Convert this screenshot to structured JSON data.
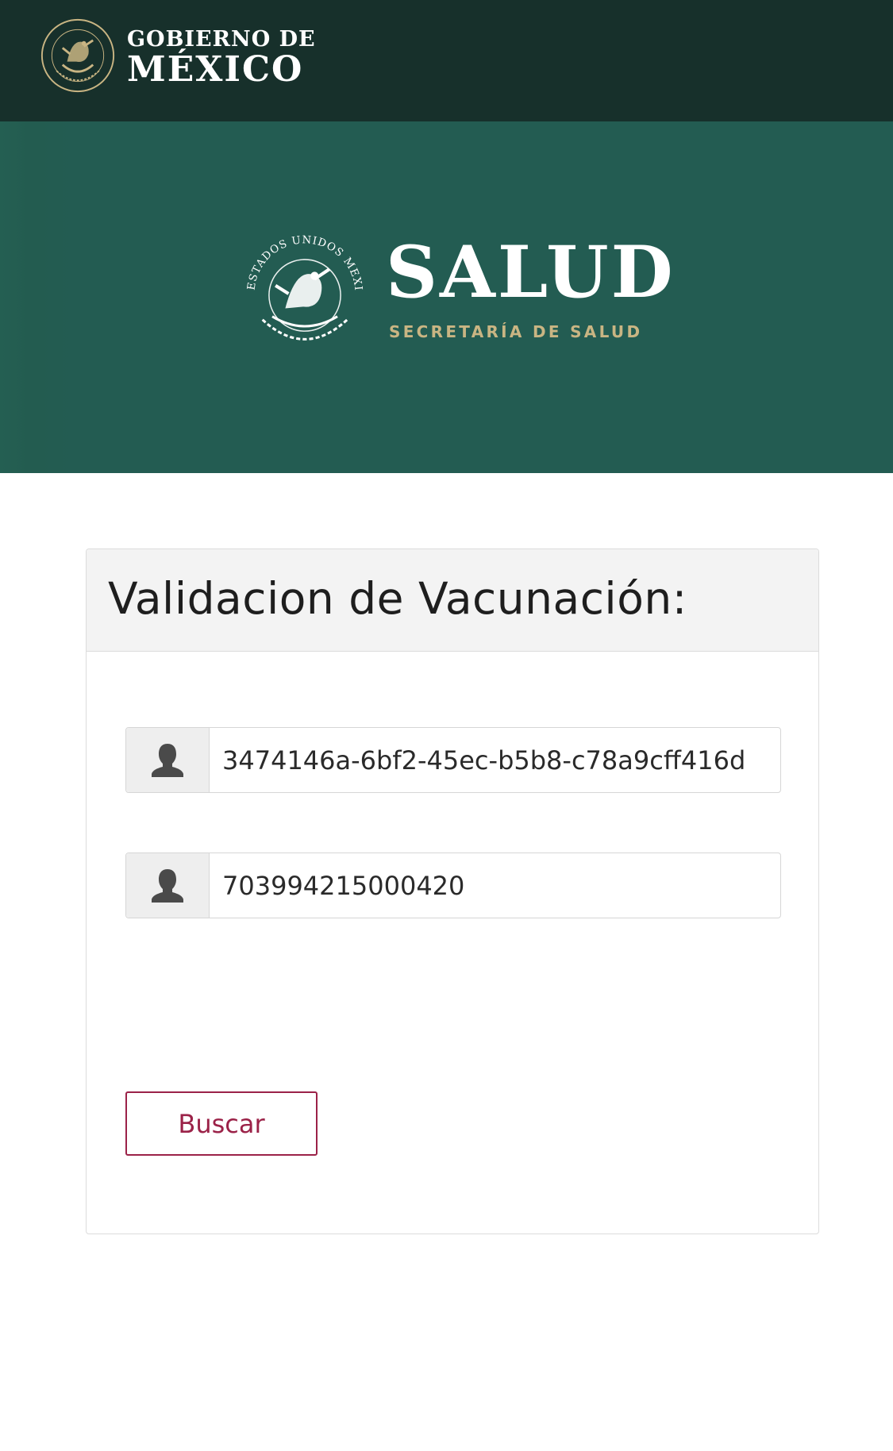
{
  "header": {
    "line1": "GOBIERNO DE",
    "line2": "MÉXICO",
    "seal_icon": "mexico-coat-of-arms-icon",
    "background": "#17302b"
  },
  "banner": {
    "title": "SALUD",
    "subtitle": "SECRETARÍA DE SALUD",
    "seal_icon": "mexico-coat-of-arms-icon",
    "seal_ring_text": "ESTADOS UNIDOS MEXICANOS",
    "background": "#235c52",
    "accent": "#c9b583"
  },
  "form": {
    "title": "Validacion de Vacunación:",
    "field1": {
      "icon": "user-icon",
      "value": "3474146a-6bf2-45ec-b5b8-c78a9cff416d"
    },
    "field2": {
      "icon": "user-icon",
      "value": "703994215000420"
    },
    "submit_label": "Buscar",
    "submit_color": "#9b2248"
  }
}
